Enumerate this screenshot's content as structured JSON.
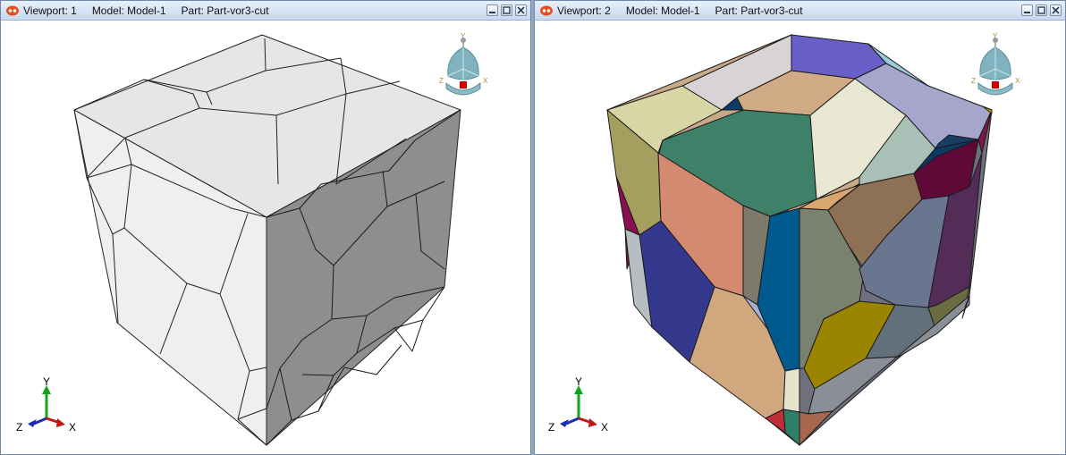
{
  "viewports": [
    {
      "title": {
        "viewport": "Viewport: 1",
        "model": "Model: Model-1",
        "part": "Part: Part-vor3-cut"
      },
      "render_mode": "shaded-grey",
      "triad": {
        "y": "Y",
        "z": "Z",
        "x": "X"
      },
      "view_manipulator": {
        "y": "Y",
        "z": "Z",
        "x": "X"
      }
    },
    {
      "title": {
        "viewport": "Viewport: 2",
        "model": "Model: Model-1",
        "part": "Part: Part-vor3-cut"
      },
      "render_mode": "colored-cells",
      "triad": {
        "y": "Y",
        "z": "Z",
        "x": "X"
      },
      "view_manipulator": {
        "y": "Y",
        "z": "Z",
        "x": "X"
      }
    }
  ],
  "colors": {
    "titlebar": "#c8d8ee",
    "top_face_grey": "#e6e6e6",
    "left_face_grey": "#efefef",
    "right_face_grey": "#8c8c8c",
    "triad_y": "#11a51c",
    "triad_x": "#c01818",
    "triad_z": "#1b2eb0",
    "manipulator": "#7fb3bf"
  },
  "icons": [
    "viewport-icon",
    "minimize-icon",
    "restore-icon",
    "close-icon"
  ]
}
